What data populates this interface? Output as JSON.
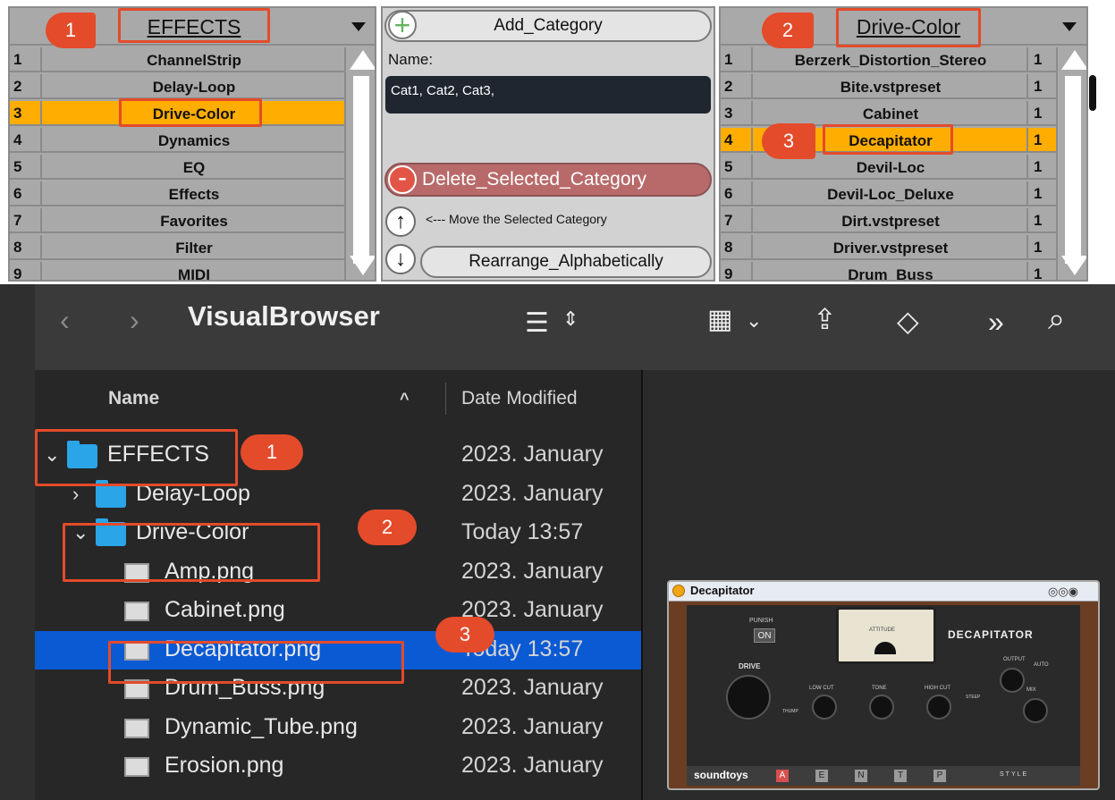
{
  "ableton": {
    "left": {
      "title": "EFFECTS",
      "badge": "1",
      "items": [
        {
          "n": "1",
          "name": "ChannelStrip"
        },
        {
          "n": "2",
          "name": "Delay-Loop"
        },
        {
          "n": "3",
          "name": "Drive-Color"
        },
        {
          "n": "4",
          "name": "Dynamics"
        },
        {
          "n": "5",
          "name": "EQ"
        },
        {
          "n": "6",
          "name": "Effects"
        },
        {
          "n": "7",
          "name": "Favorites"
        },
        {
          "n": "8",
          "name": "Filter"
        },
        {
          "n": "9",
          "name": "MIDI"
        }
      ],
      "selected_index": 2
    },
    "middle": {
      "add_label": "Add_Category",
      "add_icon": "+",
      "name_label": "Name:",
      "name_value": "Cat1, Cat2, Cat3,",
      "delete_label": "Delete_Selected_Category",
      "delete_icon": "-",
      "move_label": "<--- Move the Selected Category",
      "up_icon": "↑",
      "down_icon": "↓",
      "rearrange_label": "Rearrange_Alphabetically"
    },
    "right": {
      "title": "Drive-Color",
      "badge": "2",
      "items": [
        {
          "n": "1",
          "name": "Berzerk_Distortion_Stereo",
          "count": "1"
        },
        {
          "n": "2",
          "name": "Bite.vstpreset",
          "count": "1"
        },
        {
          "n": "3",
          "name": "Cabinet",
          "count": "1"
        },
        {
          "n": "4",
          "name": "Decapitator",
          "count": "1"
        },
        {
          "n": "5",
          "name": "Devil-Loc",
          "count": "1"
        },
        {
          "n": "6",
          "name": "Devil-Loc_Deluxe",
          "count": "1"
        },
        {
          "n": "7",
          "name": "Dirt.vstpreset",
          "count": "1"
        },
        {
          "n": "8",
          "name": "Driver.vstpreset",
          "count": "1"
        },
        {
          "n": "9",
          "name": "Drum_Buss",
          "count": "1"
        }
      ],
      "selected_index": 3,
      "selected_badge": "3"
    }
  },
  "finder": {
    "window_title": "VisualBrowser",
    "col_name": "Name",
    "col_date": "Date Modified",
    "rows": [
      {
        "name": "EFFECTS",
        "date": "2023. January",
        "kind": "folder",
        "indent": 0,
        "chev": "⌄"
      },
      {
        "name": "Delay-Loop",
        "date": "2023. January",
        "kind": "folder",
        "indent": 1,
        "chev": "›"
      },
      {
        "name": "Drive-Color",
        "date": "Today 13:57",
        "kind": "folder",
        "indent": 1,
        "chev": "⌄"
      },
      {
        "name": "Amp.png",
        "date": "2023. January",
        "kind": "image",
        "indent": 2,
        "chev": ""
      },
      {
        "name": "Cabinet.png",
        "date": "2023. January",
        "kind": "image",
        "indent": 2,
        "chev": ""
      },
      {
        "name": "Decapitator.png",
        "date": "Today 13:57",
        "kind": "image",
        "indent": 2,
        "chev": ""
      },
      {
        "name": "Drum_Buss.png",
        "date": "2023. January",
        "kind": "image",
        "indent": 2,
        "chev": ""
      },
      {
        "name": "Dynamic_Tube.png",
        "date": "2023. January",
        "kind": "image",
        "indent": 2,
        "chev": ""
      },
      {
        "name": "Erosion.png",
        "date": "2023. January",
        "kind": "image",
        "indent": 2,
        "chev": ""
      }
    ],
    "selected_index": 5,
    "badges": [
      "1",
      "2",
      "3"
    ]
  },
  "plugin": {
    "title": "Decapitator",
    "brand": "DECAPITATOR",
    "logo": "soundtoys",
    "punish": "PUNISH",
    "on": "ON",
    "drive": "DRIVE",
    "meter": "ATTITUDE",
    "output": "OUTPUT",
    "auto": "AUTO",
    "lowcut": "LOW CUT",
    "tone": "TONE",
    "highcut": "HIGH CUT",
    "thump": "THUMP",
    "steep": "STEEP",
    "mix": "MIX",
    "style": "STYLE",
    "style_buttons": [
      "A",
      "E",
      "N",
      "T",
      "P"
    ]
  },
  "colors": {
    "accent_orange": "#ffad00",
    "annotation_red": "#e34b2b",
    "finder_selection": "#0a5ad4",
    "folder_blue": "#2aa5e8"
  }
}
